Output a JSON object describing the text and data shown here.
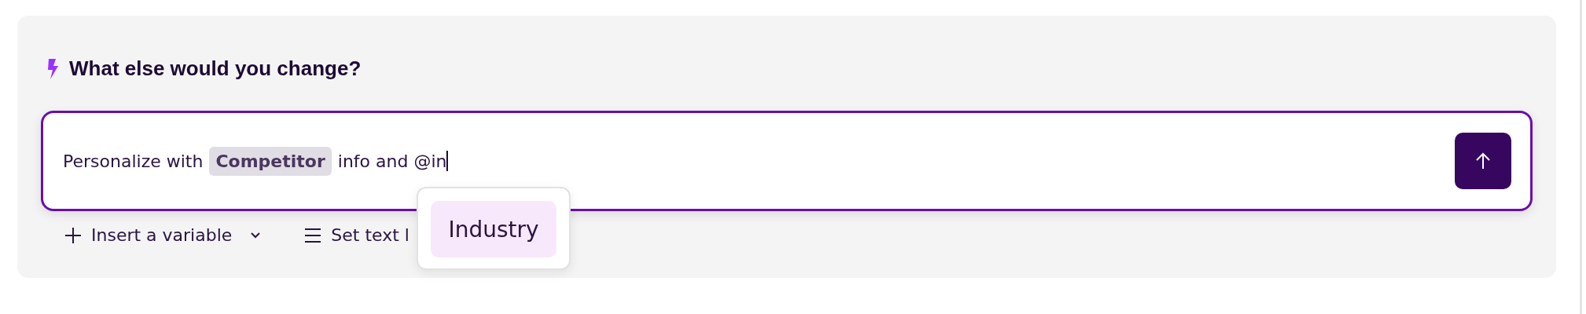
{
  "prompt": {
    "title": "What else would you change?"
  },
  "input": {
    "segments": [
      {
        "kind": "text",
        "text": "Personalize with"
      },
      {
        "kind": "chip",
        "text": "Competitor"
      },
      {
        "kind": "text",
        "text": "info and @in"
      }
    ],
    "focused": true
  },
  "toolbar": [
    {
      "label": "Insert a variable",
      "kind": "variable"
    },
    {
      "label": "Set text l",
      "kind": "text"
    }
  ],
  "suggestions": [
    {
      "label": "Industry",
      "selected": true
    }
  ]
}
